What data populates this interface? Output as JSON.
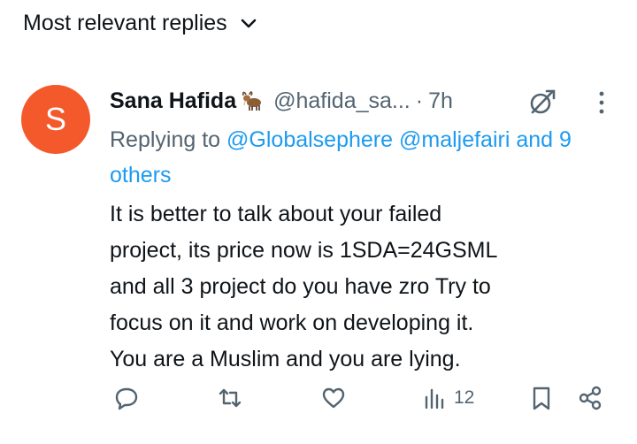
{
  "sort": {
    "label": "Most relevant replies",
    "icon": "chevron-down-icon"
  },
  "reply": {
    "avatar_letter": "S",
    "avatar_color": "#f4592b",
    "author_name": "Sana Hafida",
    "author_emoji": "goat",
    "handle": "@hafida_sa...",
    "separator": "·",
    "time": "7h",
    "replying_prefix": "Replying to",
    "mentions": [
      "@Globalsephere",
      "@maljefairi"
    ],
    "mention_more": "and 9 others",
    "text": "It is better to talk about your failed\nproject, its price now is 1SDA=24GSML\nand all 3 project do you have zro Try to\nfocus on it and work on developing it.\nYou are a Muslim and you are lying."
  },
  "actions": {
    "reply_icon": "reply-icon",
    "repost_icon": "repost-icon",
    "like_icon": "heart-icon",
    "views_icon": "views-icon",
    "views_count": "12",
    "bookmark_icon": "bookmark-icon",
    "share_icon": "share-icon"
  },
  "colors": {
    "link": "#1d9bf0",
    "secondary_text": "#536471",
    "primary_text": "#0f1419"
  }
}
